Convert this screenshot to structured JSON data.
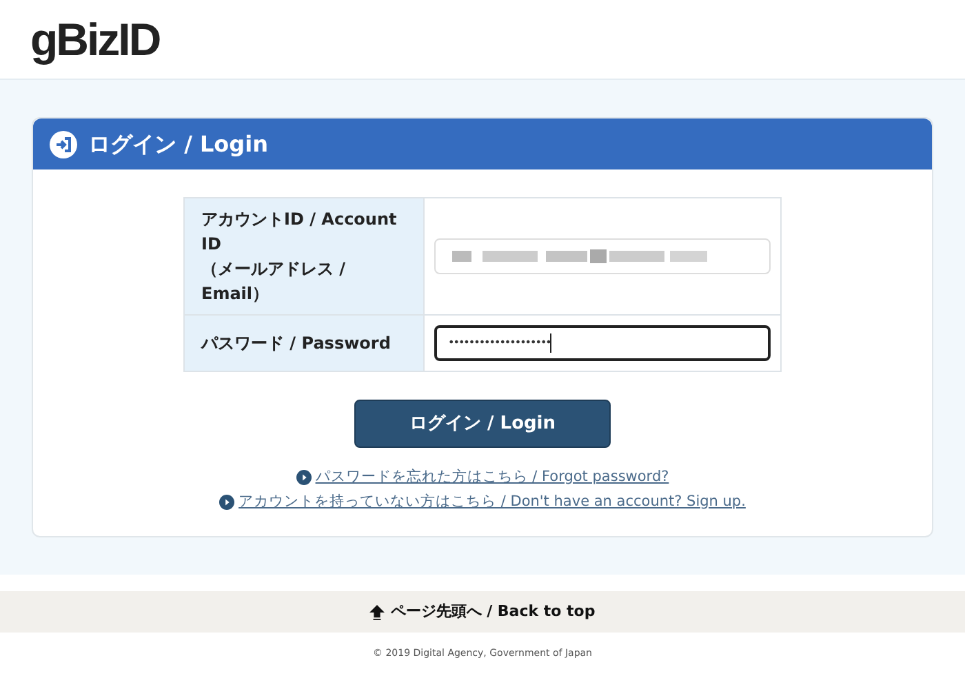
{
  "header": {
    "logo": "gBizID"
  },
  "panel": {
    "title": "ログイン / Login"
  },
  "form": {
    "fields": [
      {
        "kind": "email",
        "label": "アカウントID / Account ID\n（メールアドレス / Email）",
        "focused": false
      },
      {
        "kind": "password",
        "label": "パスワード / Password",
        "value": "••••••••••••••••••••",
        "focused": true
      }
    ]
  },
  "login_button": "ログイン / Login",
  "links": [
    "パスワードを忘れた方はこちら / Forgot password?",
    "アカウントを持っていない方はこちら / Don't have an account? Sign up."
  ],
  "footer": {
    "back_to_top": "ページ先頭へ / Back to top",
    "copyright": "© 2019 Digital Agency, Government of Japan"
  }
}
